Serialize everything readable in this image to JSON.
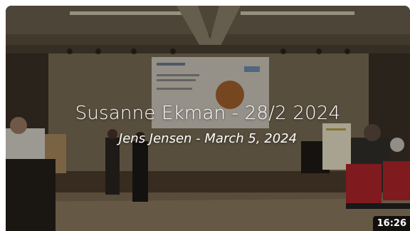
{
  "video_card": {
    "title": "Susanne Ekman - 28/2 2024",
    "subtitle": "Jens Jensen - March 5, 2024",
    "duration": "16:26"
  }
}
